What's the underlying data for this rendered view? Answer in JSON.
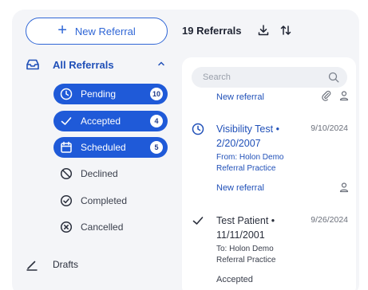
{
  "sidebar": {
    "new_referral_label": "New Referral",
    "all_referrals_label": "All Referrals",
    "statuses": [
      {
        "label": "Pending",
        "count": "10",
        "icon": "clock-icon",
        "active": true
      },
      {
        "label": "Accepted",
        "count": "4",
        "icon": "check-icon",
        "active": true
      },
      {
        "label": "Scheduled",
        "count": "5",
        "icon": "calendar-icon",
        "active": true
      },
      {
        "label": "Declined",
        "icon": "circle-slash-icon",
        "active": false
      },
      {
        "label": "Completed",
        "icon": "circle-check-icon",
        "active": false
      },
      {
        "label": "Cancelled",
        "icon": "circle-x-icon",
        "active": false
      }
    ],
    "drafts_label": "Drafts"
  },
  "header": {
    "count_title": "19 Referrals",
    "download_icon": "download-icon",
    "sort_icon": "sort-icon"
  },
  "search": {
    "placeholder": "Search"
  },
  "list": {
    "top_partial": {
      "status": "New referral"
    },
    "items": [
      {
        "name": "Visibility Test • 2/20/2007",
        "date": "9/10/2024",
        "from": "From: Holon Demo Referral Practice",
        "status": "New referral",
        "icon": "clock-icon"
      },
      {
        "name": "Test Patient • 11/11/2001",
        "date": "9/26/2024",
        "from": "To: Holon Demo Referral Practice",
        "status": "Accepted",
        "icon": "check-icon"
      }
    ]
  },
  "colors": {
    "accent": "#1f5ad8",
    "accent_text": "#2050b8",
    "background": "#f4f5f8"
  }
}
